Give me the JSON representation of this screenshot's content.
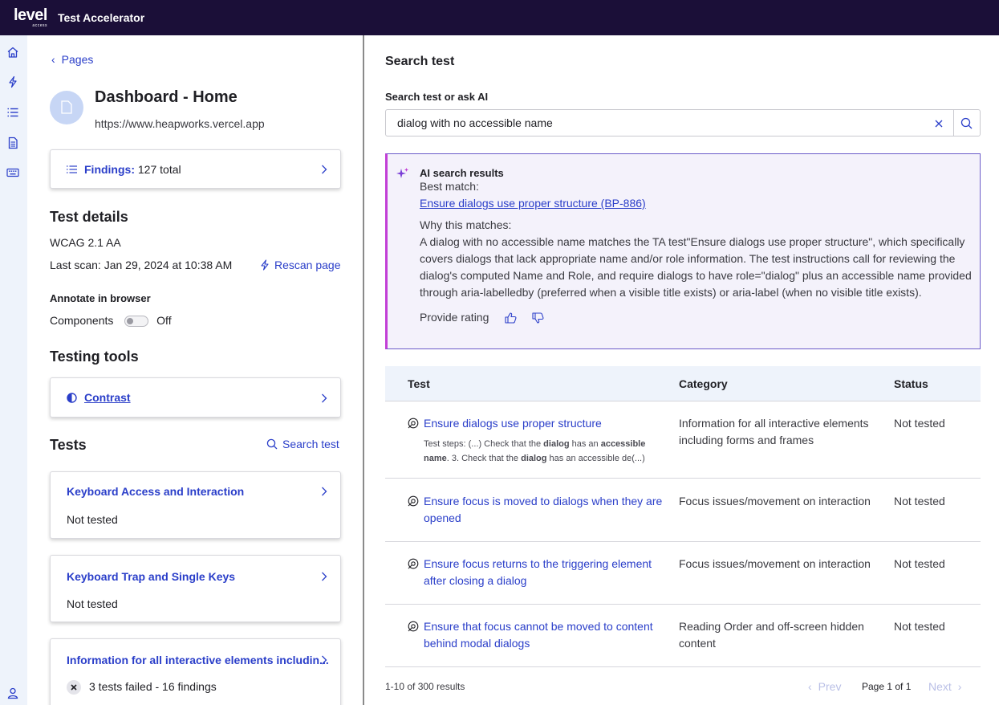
{
  "topbar": {
    "logo_word": "level",
    "logo_sub": "access",
    "app_title": "Test Accelerator"
  },
  "colors": {
    "topbar_bg": "#1b0f38",
    "accent_blue": "#2a3ec9",
    "rail_bg": "#eef3fb",
    "ai_border": "#c23fd6"
  },
  "rail": {
    "icons": [
      "home-icon",
      "bolt-icon",
      "list-icon",
      "document-icon",
      "keyboard-icon",
      "user-icon"
    ]
  },
  "left": {
    "back_link": "Pages",
    "page": {
      "title": "Dashboard - Home",
      "url": "https://www.heapworks.vercel.app"
    },
    "findings": {
      "label": "Findings:",
      "value": "127 total"
    },
    "test_details": {
      "heading": "Test details",
      "standard": "WCAG 2.1 AA",
      "last_scan": "Last scan: Jan 29, 2024 at 10:38 AM",
      "rescan": "Rescan page"
    },
    "annotate": {
      "heading": "Annotate in browser",
      "components_label": "Components",
      "toggle_state": "Off"
    },
    "testing_tools": {
      "heading": "Testing tools",
      "contrast": "Contrast"
    },
    "tests": {
      "heading": "Tests",
      "search_link": "Search test",
      "items": [
        {
          "title": "Keyboard Access and Interaction",
          "status": "Not tested"
        },
        {
          "title": "Keyboard Trap and Single Keys",
          "status": "Not tested"
        },
        {
          "title": "Information for all interactive elements includin...",
          "status": "3 tests failed - 16 findings"
        }
      ]
    }
  },
  "right": {
    "heading": "Search test",
    "search_label": "Search test or ask AI",
    "search_value": "dialog with no accessible name",
    "ai": {
      "title": "AI search results",
      "best_match_label": "Best match:",
      "best_match_link": "Ensure dialogs use proper structure (BP-886)",
      "why_label": "Why this matches:",
      "why_text": "A dialog with no accessible name matches the TA test\"Ensure dialogs use proper structure\", which specifically covers dialogs that lack appropriate name and/or role information. The test instructions call for reviewing the dialog's computed Name and Role, and require dialogs to have role=\"dialog\" plus an accessible name provided through aria-labelledby (preferred when a visible title exists) or aria-label (when no visible title exists).",
      "rating_label": "Provide rating"
    },
    "table": {
      "headers": {
        "test": "Test",
        "category": "Category",
        "status": "Status"
      },
      "rows": [
        {
          "test": "Ensure dialogs use proper structure",
          "category": "Information for all interactive elements including forms and frames",
          "status": "Not tested",
          "steps": {
            "s1": "Test steps: (...) Check that the ",
            "b1": "dialog",
            "s2": " has an ",
            "b2": "accessible name",
            "s3": ". 3. Check that the ",
            "b3": "dialog",
            "s4": " has an accessible de(...)"
          }
        },
        {
          "test": "Ensure focus is moved to dialogs when they are opened",
          "category": "Focus issues/movement on interaction",
          "status": "Not tested"
        },
        {
          "test": "Ensure focus returns to the triggering element after closing a dialog",
          "category": "Focus issues/movement on interaction",
          "status": "Not tested"
        },
        {
          "test": "Ensure that focus cannot be moved to content behind modal dialogs",
          "category": "Reading Order and off-screen hidden content",
          "status": "Not tested"
        }
      ]
    },
    "pagination": {
      "results": "1-10 of 300 results",
      "prev": "Prev",
      "page": "Page 1 of 1",
      "next": "Next"
    }
  }
}
